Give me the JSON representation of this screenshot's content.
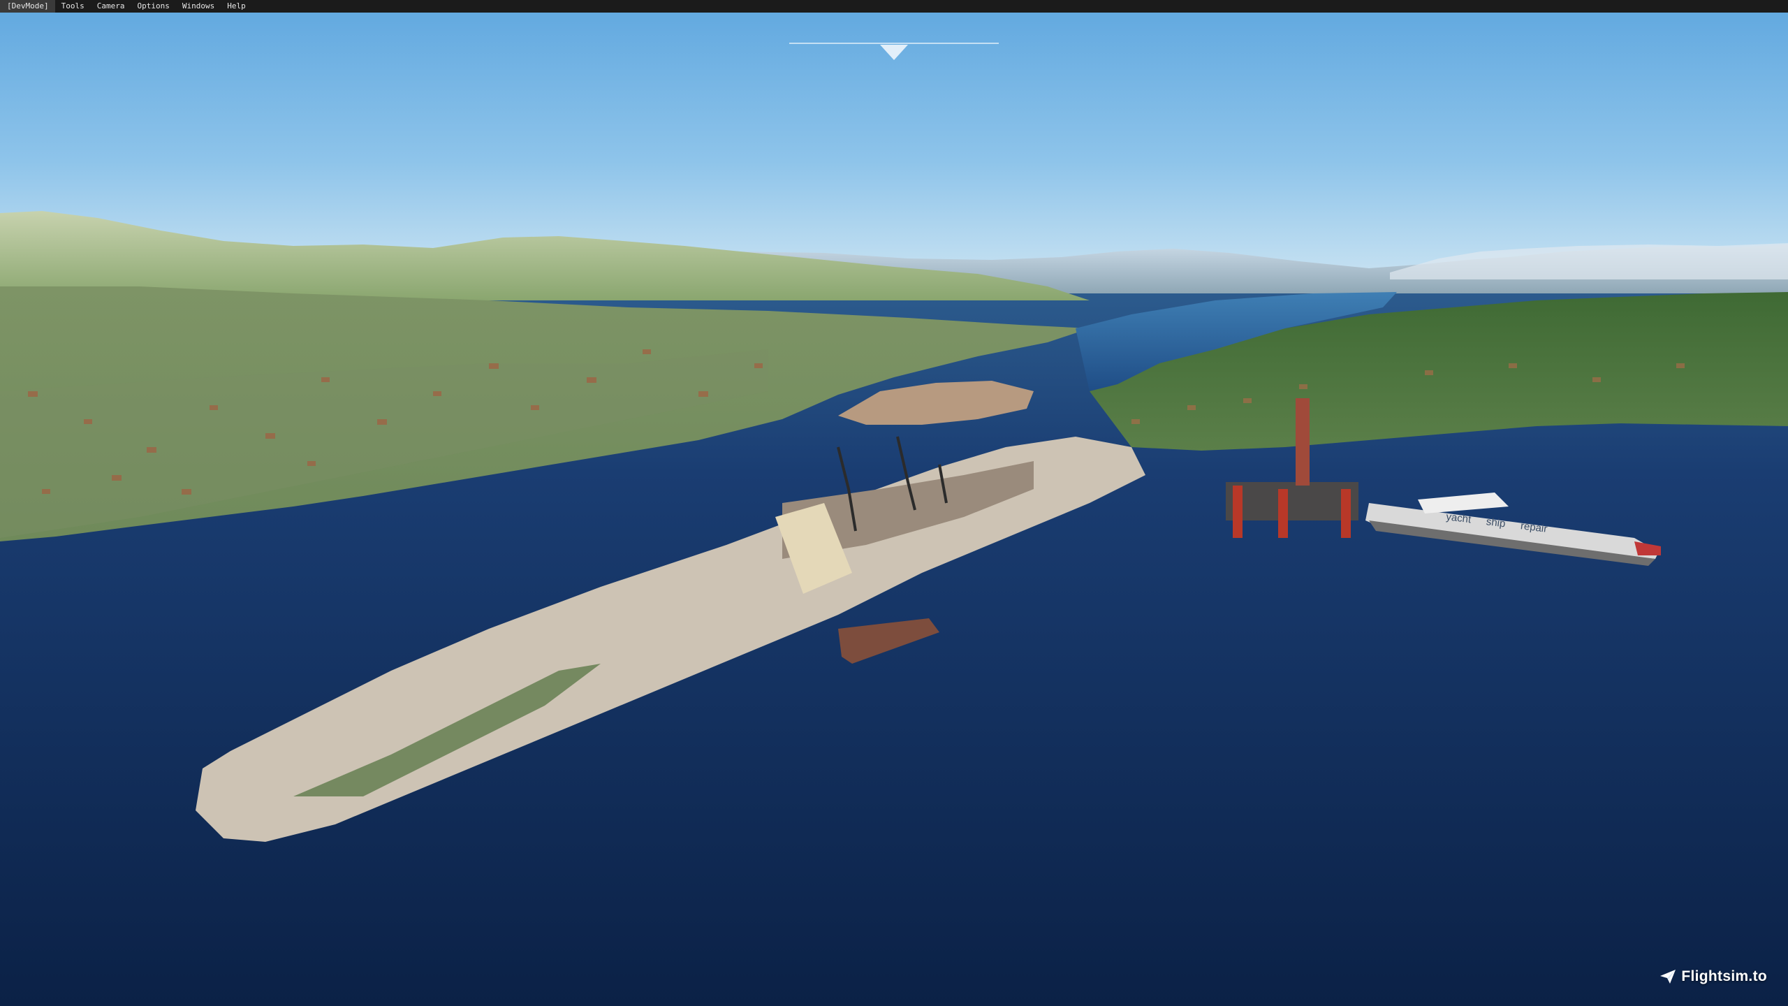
{
  "menubar": {
    "items": [
      {
        "label": "[DevMode]"
      },
      {
        "label": "Tools"
      },
      {
        "label": "Camera"
      },
      {
        "label": "Options"
      },
      {
        "label": "Windows"
      },
      {
        "label": "Help"
      }
    ]
  },
  "watermark": {
    "text": "Flightsim.to",
    "icon": "paper-plane-icon"
  },
  "hull_text": {
    "word1": "yacht",
    "word2": "ship",
    "word3": "repair"
  },
  "compass": {
    "icon": "heading-marker-icon"
  },
  "colors": {
    "sky_top": "#6aaee0",
    "sky_horizon": "#c4e2f4",
    "sea_deep": "#0e2750",
    "sea_mid": "#1a3d72",
    "hills": "#9eb587",
    "menubar_bg": "#1b1b1b"
  }
}
